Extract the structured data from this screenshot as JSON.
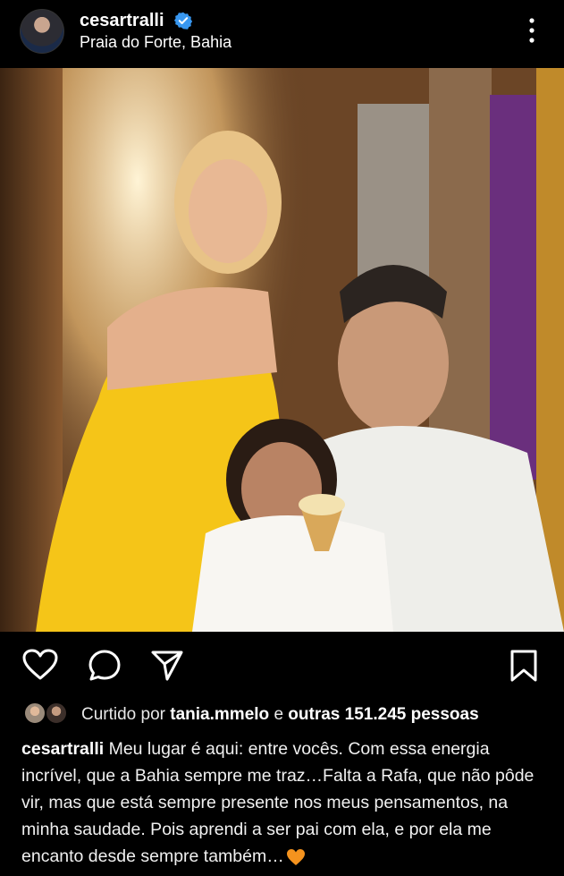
{
  "post": {
    "username": "cesartralli",
    "location": "Praia do Forte, Bahia",
    "verified": true,
    "image_alt": "Family photo: woman in yellow dress, smiling girl holding ice cream cone, man in white shirt"
  },
  "icons": {
    "more": "more-vertical-icon",
    "like": "heart-outline-icon",
    "comment": "comment-bubble-icon",
    "share": "paper-plane-icon",
    "save": "bookmark-icon"
  },
  "likes": {
    "prefix": "Curtido por",
    "first_liker": "tania.mmelo",
    "connector": "e",
    "others": "outras 151.245 pessoas"
  },
  "caption": {
    "username": "cesartralli",
    "text": "Meu lugar é aqui: entre vocês. Com essa energia incrível, que a Bahia sempre me traz…Falta a Rafa, que não pôde vir, mas que está sempre presente nos meus pensamentos, na minha saudade. Pois aprendi a ser pai com ela, e por ela me encanto desde sempre também…"
  },
  "colors": {
    "background": "#000000",
    "verified_badge": "#3897f0",
    "heart_emoji": "#f5931e"
  }
}
